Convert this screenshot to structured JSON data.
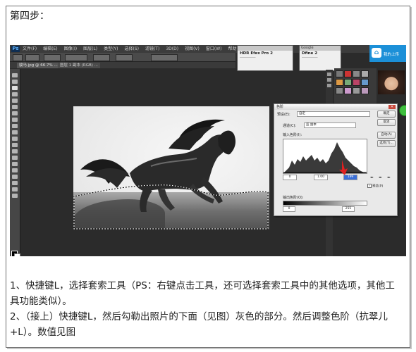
{
  "step_title": "第四步：",
  "photoshop": {
    "menu": [
      "文件(F)",
      "编辑(E)",
      "图像(I)",
      "图层(L)",
      "类型(Y)",
      "选择(S)",
      "滤镜(T)",
      "3D(D)",
      "视图(V)",
      "窗口(W)",
      "帮助(H)"
    ],
    "logo": "Ps",
    "doc_tab": "骏马.jpg @ 66.7% ...",
    "doc_tab2": "图层 1 副本 (RGB) ...",
    "ext1_title": "HDR Efex Pro 2",
    "ext2_title": "Dfine 2",
    "ext2_head": "Google",
    "badge_text": "我的上传"
  },
  "levels": {
    "title": "色阶",
    "preset_label": "预设(E):",
    "preset_value": "自定",
    "channel_label": "通道(C):",
    "channel_value": "蓝 副本",
    "input_label": "输入色阶(I):",
    "output_label": "输出色阶(O):",
    "input_values": [
      "0",
      "1.00",
      "199"
    ],
    "output_values": [
      "0",
      "255"
    ],
    "buttons": [
      "确定",
      "取消",
      "自动(A)",
      "选项(T)..."
    ],
    "preview_label": "预览(P)",
    "preview_checked": true
  },
  "paragraphs": [
    "1、快捷键L，选择套索工具（PS：右键点击工具，还可选择套索工具中的其他选项，其他工",
    "具功能类似）。",
    "2、（接上）快捷键L，然后勾勒出照片的下面（见图）灰色的部分。然后调整色阶（抗翠儿",
    "+L）。数值见图"
  ]
}
